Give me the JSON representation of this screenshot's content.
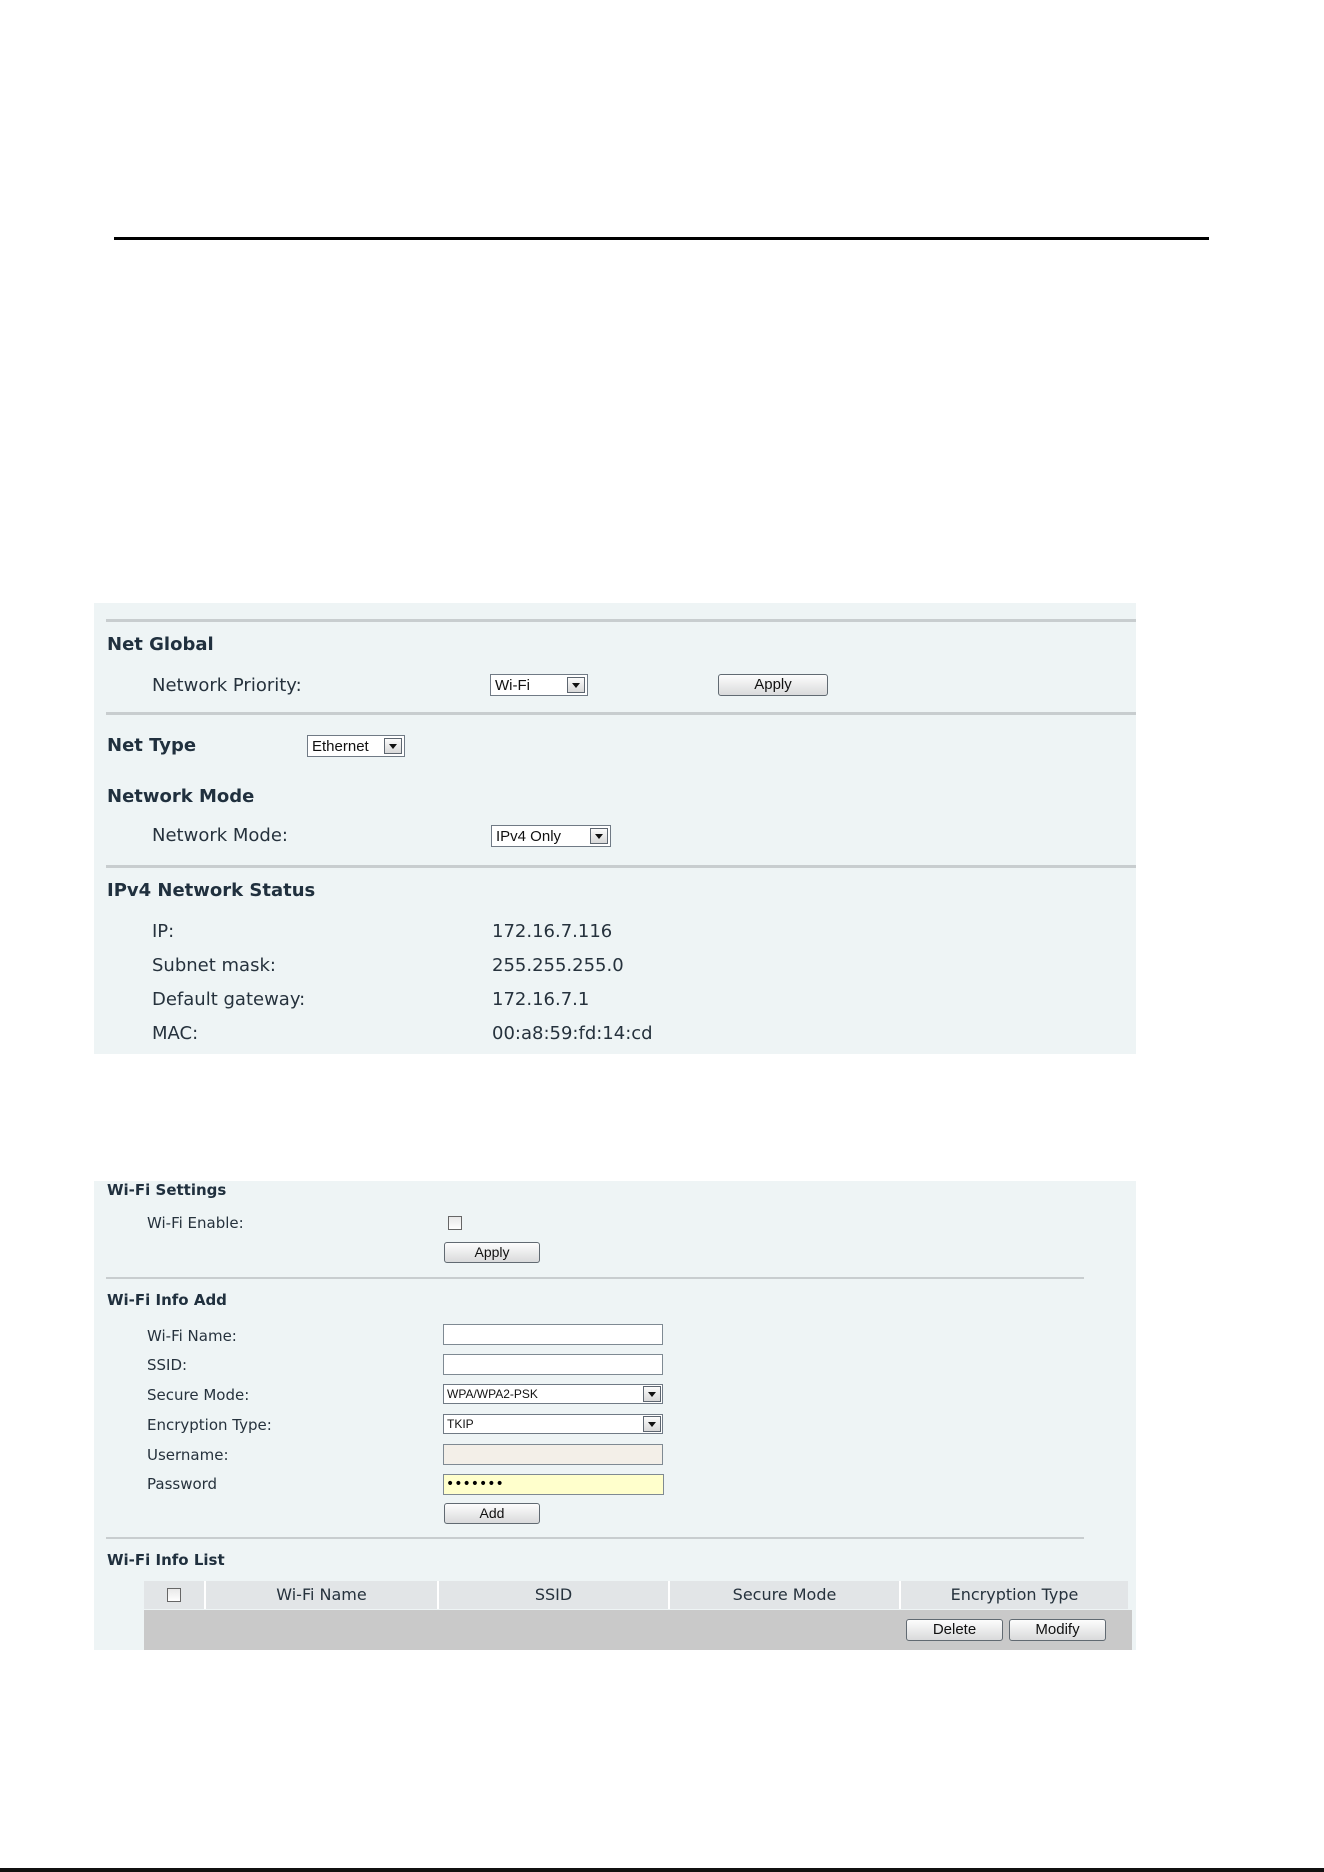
{
  "net_global": {
    "heading": "Net Global",
    "network_priority_label": "Network Priority:",
    "network_priority_value": "Wi-Fi",
    "apply_label": "Apply"
  },
  "net_type": {
    "heading": "Net Type",
    "value": "Ethernet"
  },
  "network_mode": {
    "heading": "Network Mode",
    "label": "Network Mode:",
    "value": "IPv4 Only"
  },
  "ipv4_status": {
    "heading": "IPv4 Network Status",
    "rows": [
      {
        "label": "IP:",
        "value": "172.16.7.116"
      },
      {
        "label": "Subnet mask:",
        "value": "255.255.255.0"
      },
      {
        "label": "Default gateway:",
        "value": "172.16.7.1"
      },
      {
        "label": "MAC:",
        "value": "00:a8:59:fd:14:cd"
      }
    ]
  },
  "wifi_settings": {
    "heading": "Wi-Fi Settings",
    "enable_label": "Wi-Fi Enable:",
    "enable_checked": false,
    "apply_label": "Apply"
  },
  "wifi_info_add": {
    "heading": "Wi-Fi Info Add",
    "wifi_name_label": "Wi-Fi Name:",
    "wifi_name_value": "",
    "ssid_label": "SSID:",
    "ssid_value": "",
    "secure_mode_label": "Secure Mode:",
    "secure_mode_value": "WPA/WPA2-PSK",
    "encryption_label": "Encryption Type:",
    "encryption_value": "TKIP",
    "username_label": "Username:",
    "username_value": "",
    "password_label": "Password",
    "password_value": "•••••••",
    "add_label": "Add"
  },
  "wifi_info_list": {
    "heading": "Wi-Fi Info List",
    "columns": [
      "Wi-Fi Name",
      "SSID",
      "Secure Mode",
      "Encryption Type"
    ],
    "delete_label": "Delete",
    "modify_label": "Modify"
  }
}
